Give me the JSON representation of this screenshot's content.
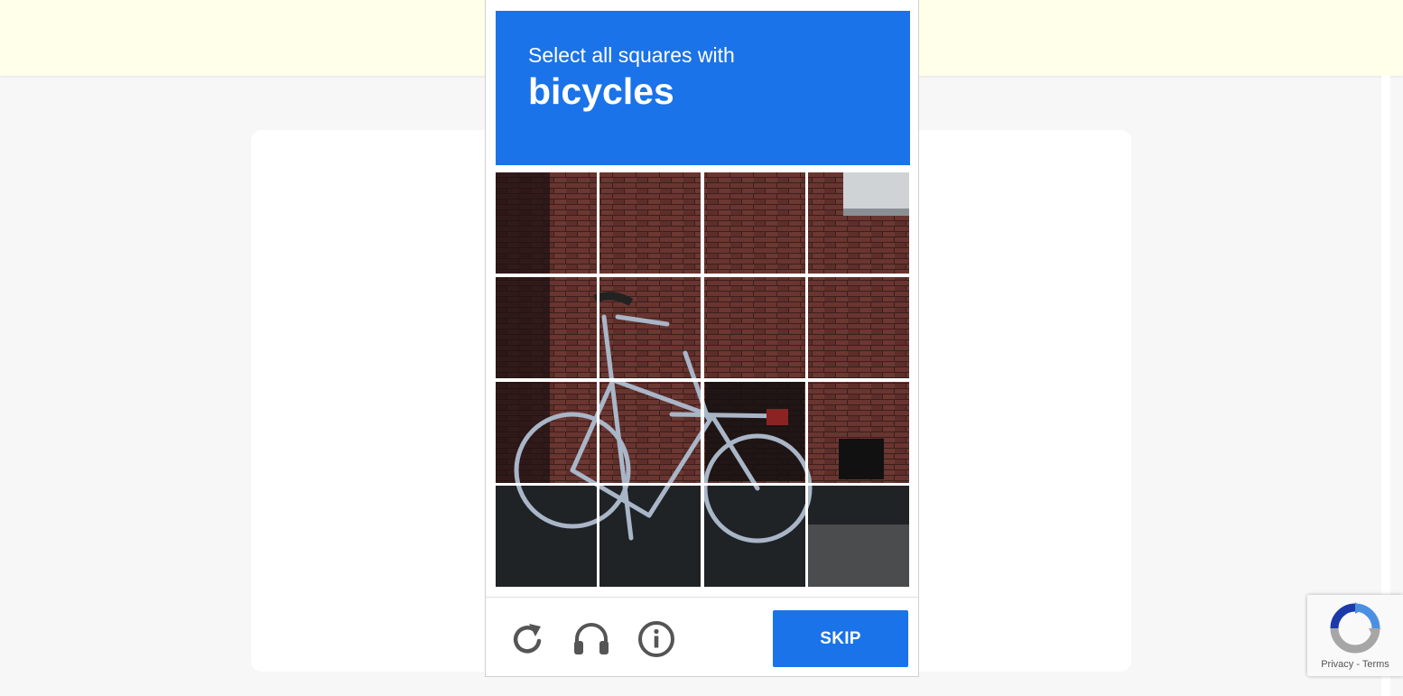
{
  "captcha": {
    "instruction": "Select all squares with",
    "target": "bicycles",
    "tiles": [
      {
        "row": 1,
        "col": 1
      },
      {
        "row": 1,
        "col": 2
      },
      {
        "row": 1,
        "col": 3
      },
      {
        "row": 1,
        "col": 4
      },
      {
        "row": 2,
        "col": 1
      },
      {
        "row": 2,
        "col": 2
      },
      {
        "row": 2,
        "col": 3
      },
      {
        "row": 2,
        "col": 4
      },
      {
        "row": 3,
        "col": 1
      },
      {
        "row": 3,
        "col": 2
      },
      {
        "row": 3,
        "col": 3
      },
      {
        "row": 3,
        "col": 4
      },
      {
        "row": 4,
        "col": 1
      },
      {
        "row": 4,
        "col": 2
      },
      {
        "row": 4,
        "col": 3
      },
      {
        "row": 4,
        "col": 4
      }
    ],
    "controls": {
      "reload_icon": "reload-icon",
      "audio_icon": "headphones-icon",
      "info_icon": "info-icon"
    },
    "skip_label": "SKIP"
  },
  "badge": {
    "privacy_label": "Privacy",
    "separator": "-",
    "terms_label": "Terms"
  },
  "colors": {
    "accent": "#1a73e8",
    "topbar": "#ffffea",
    "page_background": "#f7f7f7"
  }
}
